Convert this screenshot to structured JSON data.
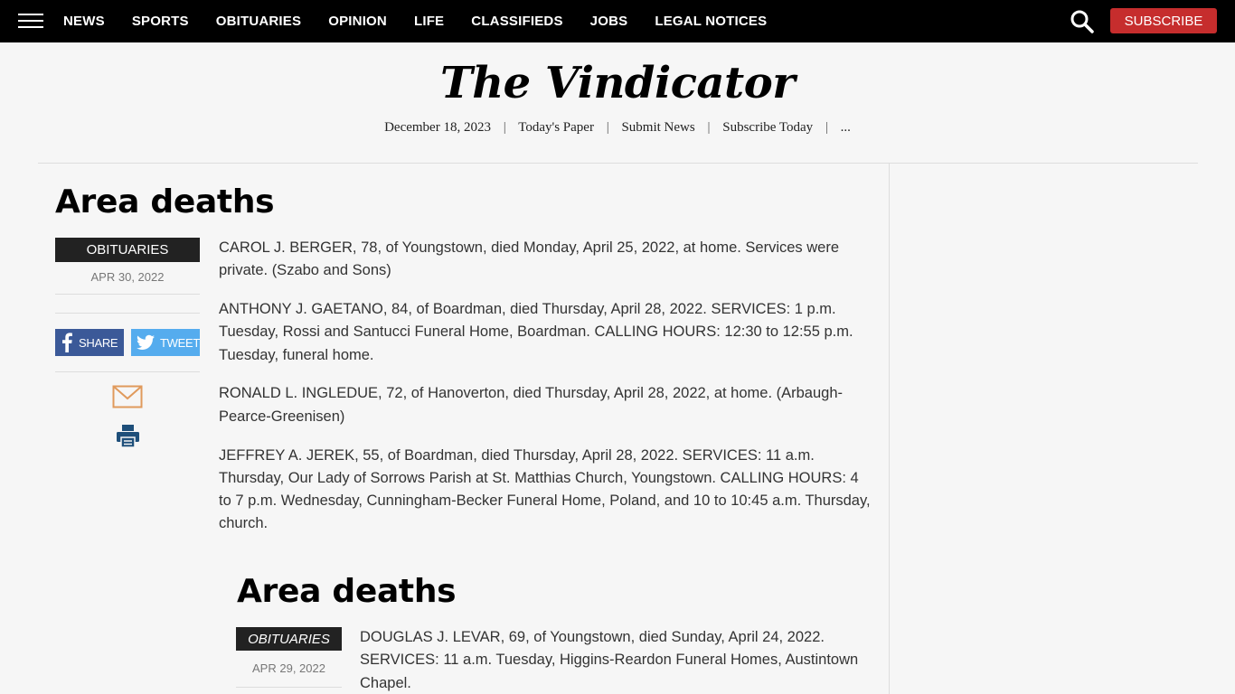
{
  "nav": {
    "items": [
      "NEWS",
      "SPORTS",
      "OBITUARIES",
      "OPINION",
      "LIFE",
      "CLASSIFIEDS",
      "JOBS",
      "LEGAL NOTICES"
    ],
    "subscribe_label": "SUBSCRIBE"
  },
  "masthead": {
    "logo": "The Vindicator",
    "date": "December 18, 2023",
    "links": [
      "Today's Paper",
      "Submit News",
      "Subscribe Today",
      "..."
    ]
  },
  "article1": {
    "headline": "Area deaths",
    "category": "OBITUARIES",
    "date": "APR 30, 2022",
    "share_fb": "SHARE",
    "share_tw": "TWEET",
    "paragraphs": [
      "CAROL J. BERGER, 78, of Youngstown, died Monday, April 25, 2022, at home. Services were private. (Szabo and Sons)",
      "ANTHONY J. GAETANO, 84, of Boardman, died Thursday, April 28, 2022. SERVICES: 1 p.m. Tuesday, Rossi and Santucci Funeral Home, Boardman. CALLING HOURS: 12:30 to 12:55 p.m. Tuesday, funeral home.",
      "RONALD L. INGLEDUE, 72, of Hanoverton, died Thursday, April 28, 2022, at home. (Arbaugh-Pearce-Greenisen)",
      "JEFFREY A. JEREK, 55, of Boardman, died Thursday, April 28, 2022. SERVICES: 11 a.m. Thursday, Our Lady of Sorrows Parish at St. Matthias Church, Youngstown. CALLING HOURS: 4 to 7 p.m. Wednesday, Cunningham-Becker Funeral Home, Poland, and 10 to 10:45 a.m. Thursday, church."
    ]
  },
  "article2": {
    "headline": "Area deaths",
    "category": "OBITUARIES",
    "date": "APR 29, 2022",
    "paragraphs": [
      "DOUGLAS J. LEVAR, 69, of Youngstown, died Sunday, April 24, 2022. SERVICES: 11 a.m. Tuesday, Higgins-Reardon Funeral Homes, Austintown Chapel."
    ]
  },
  "colors": {
    "nav_bg": "#000000",
    "subscribe_bg": "#c62d2d",
    "facebook": "#3b5998",
    "twitter": "#55acee",
    "mail_icon": "#e09a5c",
    "print_icon": "#1e4f7a"
  }
}
